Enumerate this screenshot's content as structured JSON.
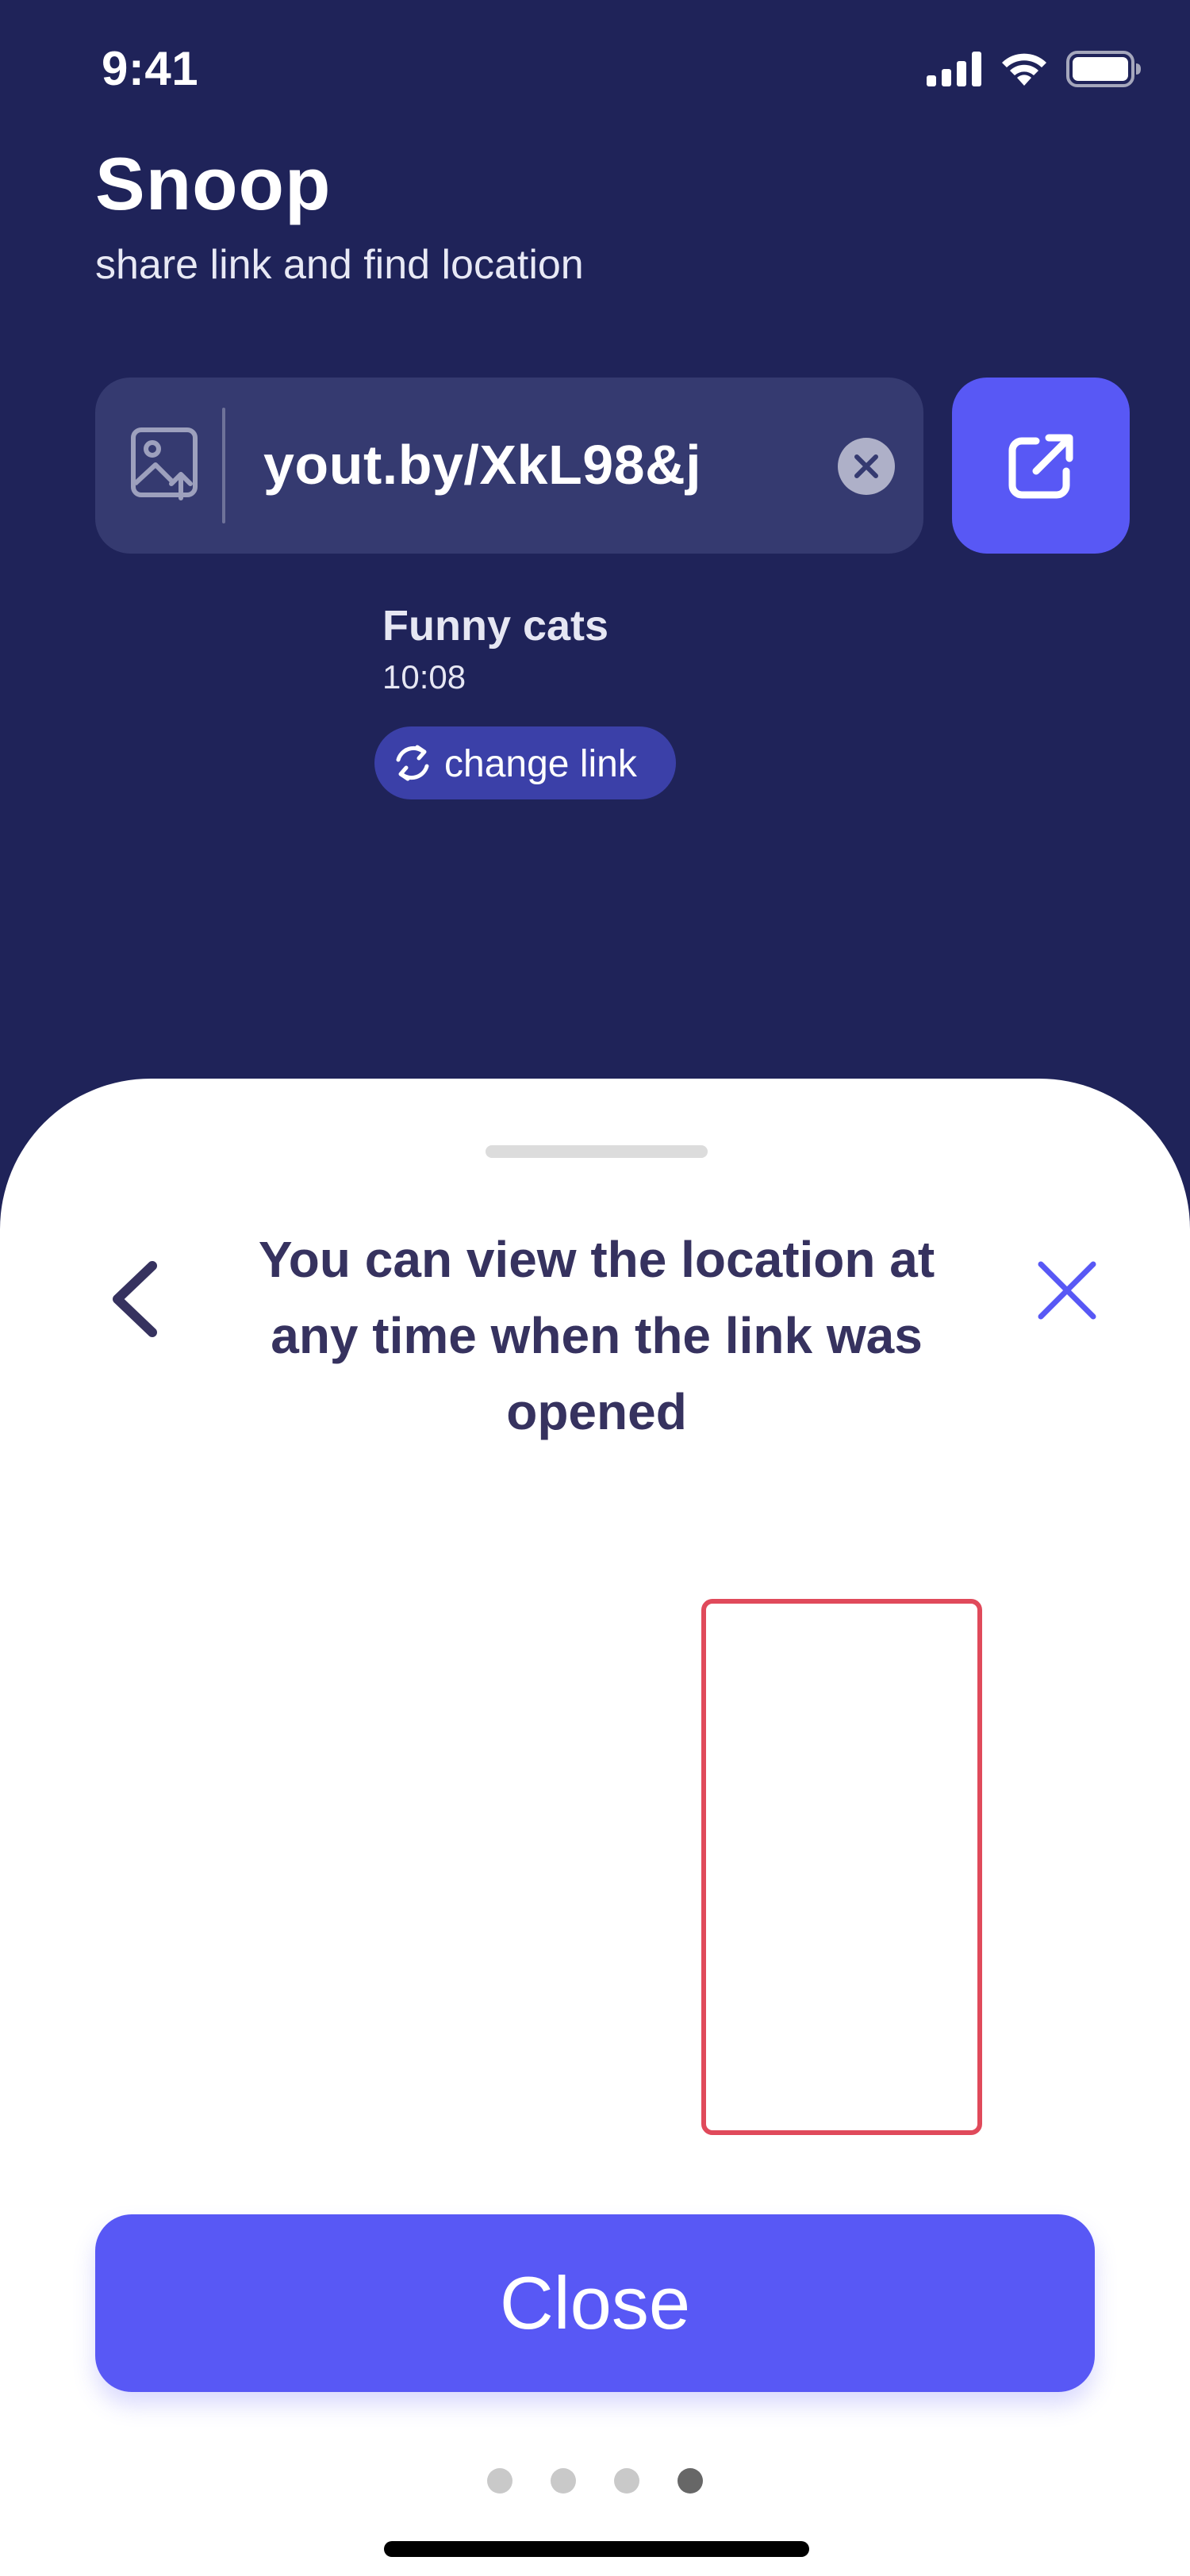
{
  "status_bar": {
    "time": "9:41"
  },
  "header": {
    "title": "Snoop",
    "subtitle": "share link and find location"
  },
  "link_field": {
    "value": "yout.by/XkL98&j",
    "image_icon": "image-upload-icon",
    "clear_icon": "close-circle-icon"
  },
  "share_button": {
    "icon": "external-link-icon"
  },
  "link_info": {
    "name": "Funny cats",
    "time": "10:08",
    "change_link_label": "change link",
    "change_link_icon": "refresh-icon"
  },
  "sheet": {
    "title": "You can view the location at any time when the link was opened",
    "back_icon": "chevron-left-icon",
    "close_icon": "close-icon",
    "close_button_label": "Close",
    "pagination": {
      "count": 4,
      "active_index": 3
    }
  },
  "colors": {
    "background": "#1f2359",
    "field": "#353a70",
    "accent": "#5858f5",
    "change_link_bg": "#3b40a8",
    "title_text": "#36325f",
    "frame_outline": "#e04a5b"
  }
}
